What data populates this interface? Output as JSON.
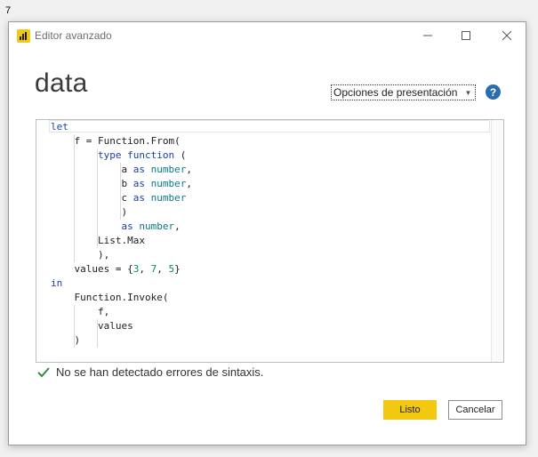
{
  "corner_label": "7",
  "window": {
    "title": "Editor avanzado",
    "icon": "power-bi-icon",
    "controls": [
      "minimize-icon",
      "maximize-icon",
      "close-icon"
    ]
  },
  "doc_title": "data",
  "display_options": {
    "label": "Opciones de presentación"
  },
  "help": {
    "glyph": "?"
  },
  "editor": {
    "lines": [
      "let",
      "    f = Function.From(",
      "        type function (",
      "            a as number,",
      "            b as number,",
      "            c as number",
      "            )",
      "            as number,",
      "        List.Max",
      "        ),",
      "    values = {3, 7, 5}",
      "in",
      "    Function.Invoke(",
      "        f,",
      "        values",
      "    )"
    ]
  },
  "status": {
    "text": "No se han detectado errores de sintaxis.",
    "icon": "checkmark-icon"
  },
  "buttons": {
    "done": "Listo",
    "cancel": "Cancelar"
  },
  "colors": {
    "accent": "#f2c811",
    "keyword": "#1c3fa3",
    "type": "#0b7a8a",
    "success": "#3a8a3a",
    "help": "#2b6cb0"
  }
}
